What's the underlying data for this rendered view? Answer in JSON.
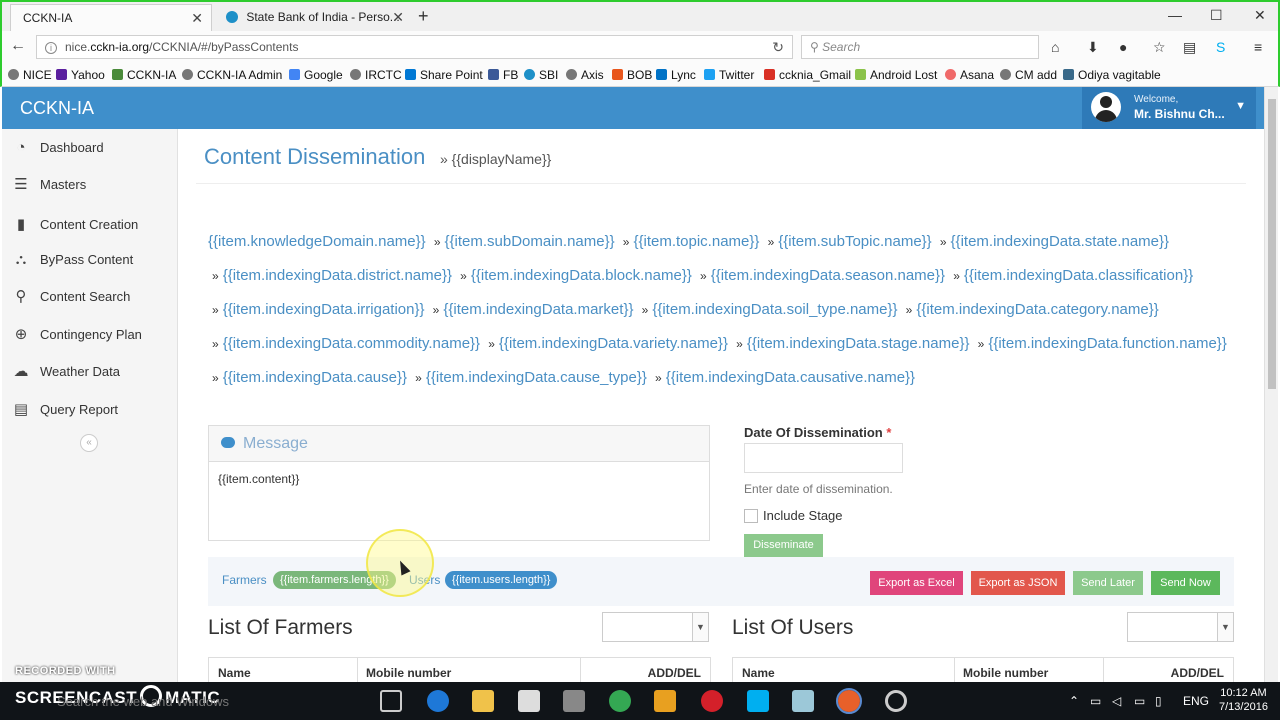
{
  "browser": {
    "tabs": [
      {
        "title": "CCKN-IA",
        "close": "✕"
      },
      {
        "title": "State Bank of India - Perso...",
        "close": "✕"
      }
    ],
    "new_tab": "+",
    "window_controls": [
      "—",
      "☐",
      "✕"
    ],
    "url_prefix": "nice.",
    "url_domain": "cckn-ia.org",
    "url_path": "/CCKNIA/#/byPassContents",
    "reload_icon": "↻",
    "search_placeholder": "Search",
    "nav_icons": [
      "home-icon",
      "download-icon",
      "chat-icon",
      "star-icon",
      "reading-list-icon",
      "skype-icon",
      "menu-icon"
    ],
    "bookmarks": [
      {
        "label": "NICE",
        "icon": "globe-icon",
        "color": "#777777"
      },
      {
        "label": "Yahoo",
        "icon": "yahoo-icon",
        "color": "#5a1f9e"
      },
      {
        "label": "CCKN-IA",
        "icon": "ccknia-icon",
        "color": "#4a8a3a"
      },
      {
        "label": "CCKN-IA Admin",
        "icon": "globe-icon",
        "color": "#777777"
      },
      {
        "label": "Google",
        "icon": "google-icon",
        "color": "#4285f4"
      },
      {
        "label": "IRCTC",
        "icon": "globe-icon",
        "color": "#777777"
      },
      {
        "label": "Share Point",
        "icon": "sharepoint-icon",
        "color": "#0078d4"
      },
      {
        "label": "FB",
        "icon": "facebook-icon",
        "color": "#3b5998"
      },
      {
        "label": "SBI",
        "icon": "sbi-icon",
        "color": "#1e90c8"
      },
      {
        "label": "Axis",
        "icon": "globe-icon",
        "color": "#777777"
      },
      {
        "label": "BOB",
        "icon": "bob-icon",
        "color": "#e8561c"
      },
      {
        "label": "Lync",
        "icon": "lync-icon",
        "color": "#0072c6"
      },
      {
        "label": "Twitter",
        "icon": "twitter-icon",
        "color": "#1da1f2"
      },
      {
        "label": "ccknia_Gmail",
        "icon": "gmail-icon",
        "color": "#d93025"
      },
      {
        "label": "Android Lost",
        "icon": "android-icon",
        "color": "#8bc34a"
      },
      {
        "label": "Asana",
        "icon": "asana-icon",
        "color": "#f06a6a"
      },
      {
        "label": "CM add",
        "icon": "globe-icon",
        "color": "#777777"
      },
      {
        "label": "Odiya vagitable",
        "icon": "image-icon",
        "color": "#3a6a8a"
      }
    ]
  },
  "app": {
    "brand": "CCKN-IA",
    "welcome": "Welcome,",
    "user_name": "Mr. Bishnu Ch...",
    "caret": "▼",
    "header_color": "#3f8fcb"
  },
  "sidebar": {
    "items": [
      {
        "label": "Dashboard",
        "icon": "dashboard-icon",
        "glyph": "◔"
      },
      {
        "label": "Masters",
        "icon": "list-icon",
        "glyph": "☰"
      },
      {
        "label": "Content Creation",
        "icon": "book-icon",
        "glyph": "▮"
      },
      {
        "label": "ByPass Content",
        "icon": "binoculars-icon",
        "glyph": "⛬"
      },
      {
        "label": "Content Search",
        "icon": "search-icon",
        "glyph": "⚲"
      },
      {
        "label": "Contingency Plan",
        "icon": "lifebuoy-icon",
        "glyph": "⊕"
      },
      {
        "label": "Weather Data",
        "icon": "cloud-icon",
        "glyph": "☁"
      },
      {
        "label": "Query Report",
        "icon": "report-icon",
        "glyph": "▤"
      }
    ],
    "collapse": "«"
  },
  "main": {
    "title": "Content Dissemination",
    "subtitle": "» {{displayName}}",
    "separator": "»",
    "crumbs": [
      "{{item.knowledgeDomain.name}}",
      "{{item.subDomain.name}}",
      "{{item.topic.name}}",
      "{{item.subTopic.name}}",
      "{{item.indexingData.state.name}}",
      "{{item.indexingData.district.name}}",
      "{{item.indexingData.block.name}}",
      "{{item.indexingData.season.name}}",
      "{{item.indexingData.classification}}",
      "{{item.indexingData.irrigation}}",
      "{{item.indexingData.market}}",
      "{{item.indexingData.soil_type.name}}",
      "{{item.indexingData.category.name}}",
      "{{item.indexingData.commodity.name}}",
      "{{item.indexingData.variety.name}}",
      "{{item.indexingData.stage.name}}",
      "{{item.indexingData.function.name}}",
      "{{item.indexingData.cause}}",
      "{{item.indexingData.cause_type}}",
      "{{item.indexingData.causative.name}}"
    ],
    "message": {
      "title": "Message",
      "content": "{{item.content}}"
    },
    "date": {
      "label": "Date Of Dissemination",
      "required": "*",
      "value": "",
      "help": "Enter date of dissemination."
    },
    "include_stage": {
      "label": "Include Stage",
      "checked": false
    },
    "disseminate_label": "Disseminate",
    "counts": {
      "farmers_label": "Farmers",
      "farmers_count": "{{item.farmers.length}}",
      "users_label": "Users",
      "users_count": "{{item.users.length}}"
    },
    "actions": [
      {
        "label": "Export as Excel",
        "color": "#e0457b"
      },
      {
        "label": "Export as JSON",
        "color": "#e2574c"
      },
      {
        "label": "Send Later",
        "color": "#8cc98c"
      },
      {
        "label": "Send Now",
        "color": "#5cb85c"
      }
    ],
    "farmers_list": {
      "title": "List Of Farmers",
      "select_value": "",
      "columns": [
        "Name",
        "Mobile number",
        "ADD/DEL"
      ]
    },
    "users_list": {
      "title": "List Of Users",
      "select_value": "",
      "columns": [
        "Name",
        "Mobile number",
        "ADD/DEL"
      ]
    }
  },
  "taskbar": {
    "watermark_top": "RECORDED WITH",
    "watermark_left": "SCREENCAST",
    "watermark_right": "MATIC",
    "search_hint": "Search the web and Windows",
    "language": "ENG",
    "time": "10:12 AM",
    "date": "7/13/2016"
  }
}
